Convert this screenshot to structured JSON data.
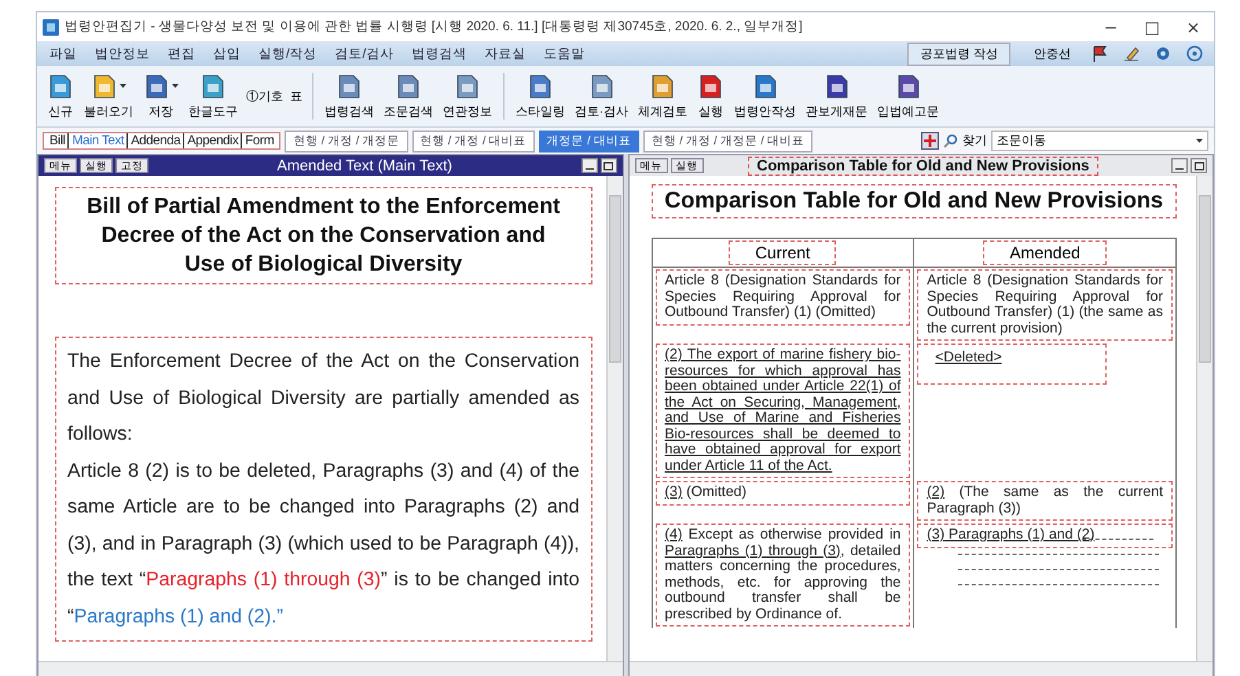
{
  "window": {
    "title": "법령안편집기 - 생물다양성 보전 및 이용에 관한 법률 시행령 [시행 2020. 6. 11.] [대통령령 제30745호, 2020. 6. 2., 일부개정]",
    "controls": [
      "−",
      "□",
      "×"
    ]
  },
  "menu": {
    "items": [
      "파일",
      "법안정보",
      "편집",
      "삽입",
      "실행/작성",
      "검토/검사",
      "법령검색",
      "자료실",
      "도움말"
    ],
    "right_button": "공포법령 작성",
    "user": "안중선"
  },
  "toolbar": {
    "groups": [
      [
        {
          "label": "신규",
          "kind": "large",
          "dropdown": false
        },
        {
          "label": "불러오기",
          "kind": "large",
          "dropdown": true
        },
        {
          "label": "저장",
          "kind": "large",
          "dropdown": true
        },
        {
          "label": "한글도구",
          "kind": "large",
          "dropdown": false
        },
        {
          "label": "①기호",
          "kind": "small",
          "dropdown": false
        },
        {
          "label": "표",
          "kind": "small",
          "dropdown": false
        }
      ],
      [
        {
          "label": "법령검색",
          "kind": "large",
          "dropdown": false
        },
        {
          "label": "조문검색",
          "kind": "large",
          "dropdown": false
        },
        {
          "label": "연관정보",
          "kind": "large",
          "dropdown": false
        }
      ],
      [
        {
          "label": "스타일링",
          "kind": "large",
          "dropdown": false
        },
        {
          "label": "검토·검사",
          "kind": "large",
          "dropdown": false
        },
        {
          "label": "체계검토",
          "kind": "large",
          "dropdown": false
        },
        {
          "label": "실행",
          "kind": "large",
          "dropdown": false
        },
        {
          "label": "법령안작성",
          "kind": "large",
          "dropdown": false
        },
        {
          "label": "관보게재문",
          "kind": "large",
          "dropdown": false
        },
        {
          "label": "입법예고문",
          "kind": "large",
          "dropdown": false
        }
      ]
    ]
  },
  "doc_tabs": [
    {
      "label": "Bill",
      "selected": false
    },
    {
      "label": "Main Text",
      "selected": true
    },
    {
      "label": "Addenda",
      "selected": false
    },
    {
      "label": "Appendix",
      "selected": false
    },
    {
      "label": "Form",
      "selected": false
    }
  ],
  "view_tabs": [
    {
      "label": "현행 / 개정 / 개정문",
      "selected": false
    },
    {
      "label": "현행 / 개정 / 대비표",
      "selected": false
    },
    {
      "label": "개정문 / 대비표",
      "selected": true
    },
    {
      "label": "현행 / 개정 / 개정문 / 대비표",
      "selected": false
    }
  ],
  "search": {
    "label": "찾기",
    "value": "조문이동"
  },
  "left_panel": {
    "buttons": [
      "메뉴",
      "실행",
      "고정"
    ],
    "title": "Amended Text (Main Text)",
    "heading": "Bill of Partial Amendment to the Enforcement Decree of the Act on the Conservation and Use of Biological Diversity",
    "paragraphs": [
      [
        {
          "text": "The Enforcement Decree of the Act on the Conservation and Use of Biological Diversity are partially amended as follows:",
          "color": "#222222"
        }
      ],
      [
        {
          "text": "Article 8 (2) is to be deleted, Paragraphs (3) and (4) of the same Article are to be changed into Paragraphs (2) and (3), and in Paragraph (3) (which used to be Paragraph (4)), the text “",
          "color": "#222222"
        },
        {
          "text": "Paragraphs (1) through (3)",
          "color": "#e8202a"
        },
        {
          "text": "” is to be changed into “",
          "color": "#222222"
        },
        {
          "text": "Paragraphs (1) and (2).”",
          "color": "#2a78c8"
        }
      ]
    ]
  },
  "right_panel": {
    "buttons": [
      "메뉴",
      "실행"
    ],
    "title": "Comparison Table for Old and New Provisions",
    "heading": "Comparison Table for Old and New Provisions",
    "table": {
      "columns": [
        "Current",
        "Amended"
      ],
      "rows": [
        {
          "current": [
            {
              "text": "Article 8 (Designation Standards for Species Requiring Approval for Outbound Transfer) (1) (Omitted)",
              "underlined": false
            }
          ],
          "amended": [
            {
              "text": "Article 8 (Designation Standards for Species Requiring Approval for Outbound Transfer) (1) (the same as the current provision)",
              "underlined": false
            }
          ]
        },
        {
          "current": [
            {
              "text": "(2) The export of marine fishery bio-resources for which approval has been obtained under Article 22(1) of the Act on Securing, Management, and Use of Marine and Fisheries Bio-resources shall be deemed to have obtained approval for export under Article 11 of the Act.",
              "underlined": true
            }
          ],
          "amended": [
            {
              "text": "<Deleted>",
              "underlined": true
            }
          ]
        },
        {
          "current": [
            {
              "text": "(3)",
              "underlined": true
            },
            {
              "text": " (Omitted)",
              "underlined": false
            }
          ],
          "amended": [
            {
              "text": "(2)",
              "underlined": true
            },
            {
              "text": " (The same as the current Paragraph (3))",
              "underlined": false
            }
          ]
        },
        {
          "current": [
            {
              "text": "(4)",
              "underlined": true
            },
            {
              "text": " Except as otherwise provided in ",
              "underlined": false
            },
            {
              "text": "Paragraphs (1) through (3)",
              "underlined": true
            },
            {
              "text": ", detailed matters concerning the procedures, methods, etc. for approving the outbound transfer shall be prescribed by Ordinance of.",
              "underlined": false
            }
          ],
          "amended": [
            {
              "text": "(3)",
              "underlined": true
            },
            {
              "text": " Paragraphs (1) and (2)",
              "underlined": true
            }
          ]
        }
      ]
    }
  }
}
